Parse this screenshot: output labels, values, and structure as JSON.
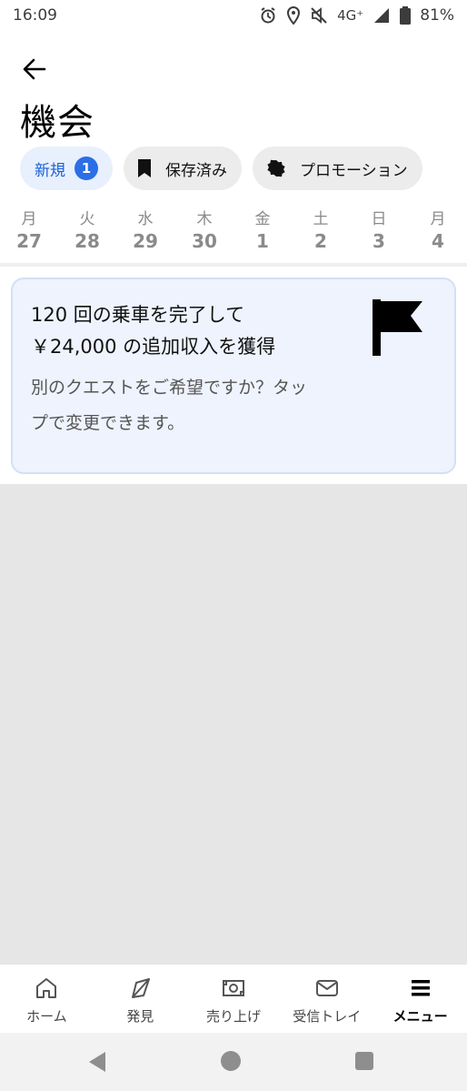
{
  "status_bar": {
    "time": "16:09",
    "network": "4G⁺",
    "battery": "81%"
  },
  "header": {
    "title": "機会"
  },
  "chips": {
    "new_label": "新規",
    "new_count": "1",
    "saved_label": "保存済み",
    "promotion_label": "プロモーション"
  },
  "dates": [
    {
      "dow": "月",
      "day": "27"
    },
    {
      "dow": "火",
      "day": "28"
    },
    {
      "dow": "水",
      "day": "29"
    },
    {
      "dow": "木",
      "day": "30"
    },
    {
      "dow": "金",
      "day": "1"
    },
    {
      "dow": "土",
      "day": "2"
    },
    {
      "dow": "日",
      "day": "3"
    },
    {
      "dow": "月",
      "day": "4"
    }
  ],
  "card": {
    "title_line1": "120 回の乗車を完了して",
    "title_line2": "￥24,000 の追加収入を獲得",
    "body_line1": "別のクエストをご希望ですか？タッ",
    "body_line2": "プで変更できます。",
    "icon": "flag-icon"
  },
  "bottom_nav": {
    "items": [
      {
        "label": "ホーム",
        "icon": "home-icon"
      },
      {
        "label": "発見",
        "icon": "compass-icon"
      },
      {
        "label": "売り上げ",
        "icon": "earnings-icon"
      },
      {
        "label": "受信トレイ",
        "icon": "inbox-icon"
      },
      {
        "label": "メニュー",
        "icon": "menu-icon"
      }
    ],
    "active_index": 4
  },
  "colors": {
    "accent": "#2b6ee6",
    "card_bg": "#eef3fd",
    "gray_area": "#e6e6e6"
  }
}
